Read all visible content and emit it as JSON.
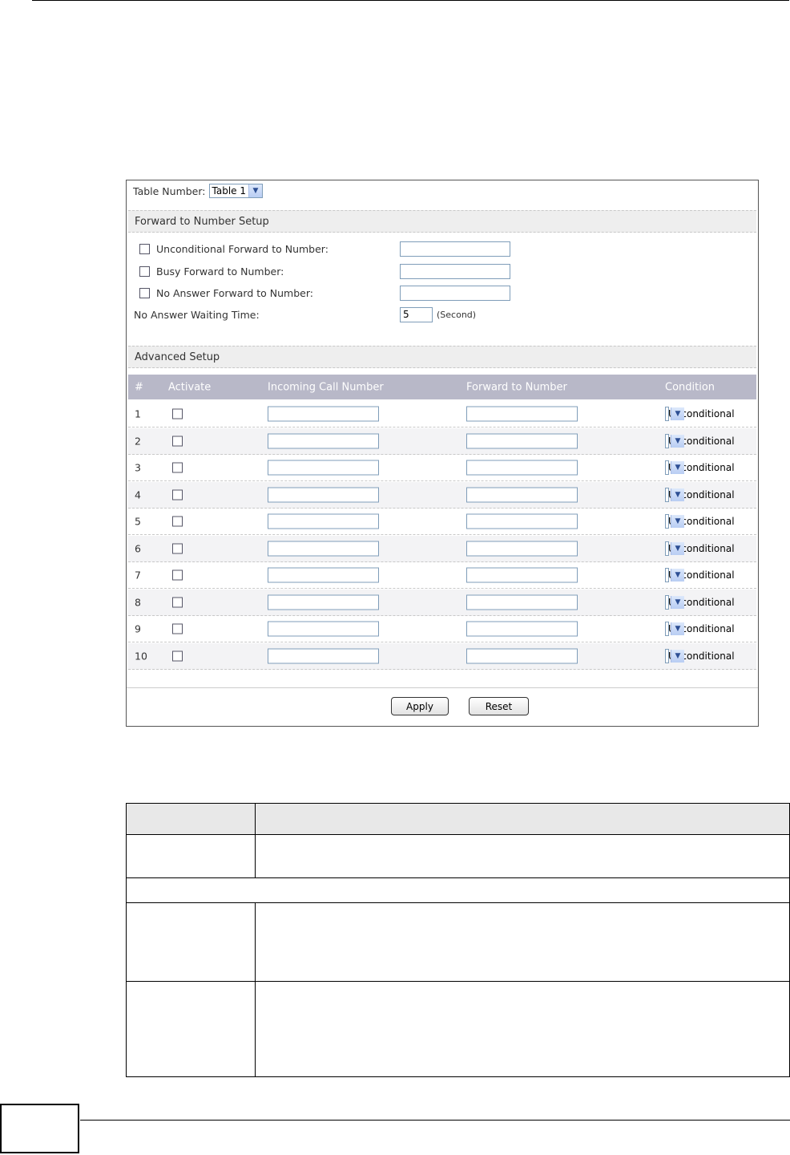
{
  "table_number": {
    "label": "Table Number:",
    "selected": "Table 1"
  },
  "forward_section": {
    "title": "Forward to Number Setup",
    "unconditional_label": "Unconditional Forward to Number:",
    "busy_label": "Busy Forward to Number:",
    "no_answer_label": "No Answer Forward to Number:",
    "waiting_label": "No Answer Waiting Time:",
    "waiting_value": "5",
    "waiting_unit": "(Second)"
  },
  "advanced_section": {
    "title": "Advanced Setup",
    "columns": [
      "#",
      "Activate",
      "Incoming Call Number",
      "Forward to Number",
      "Condition"
    ],
    "rows": [
      {
        "num": "1",
        "condition": "Unconditional"
      },
      {
        "num": "2",
        "condition": "Unconditional"
      },
      {
        "num": "3",
        "condition": "Unconditional"
      },
      {
        "num": "4",
        "condition": "Unconditional"
      },
      {
        "num": "5",
        "condition": "Unconditional"
      },
      {
        "num": "6",
        "condition": "Unconditional"
      },
      {
        "num": "7",
        "condition": "Unconditional"
      },
      {
        "num": "8",
        "condition": "Unconditional"
      },
      {
        "num": "9",
        "condition": "Unconditional"
      },
      {
        "num": "10",
        "condition": "Unconditional"
      }
    ]
  },
  "buttons": {
    "apply": "Apply",
    "reset": "Reset"
  },
  "icons": {
    "dropdown": "chevron-down-icon"
  }
}
